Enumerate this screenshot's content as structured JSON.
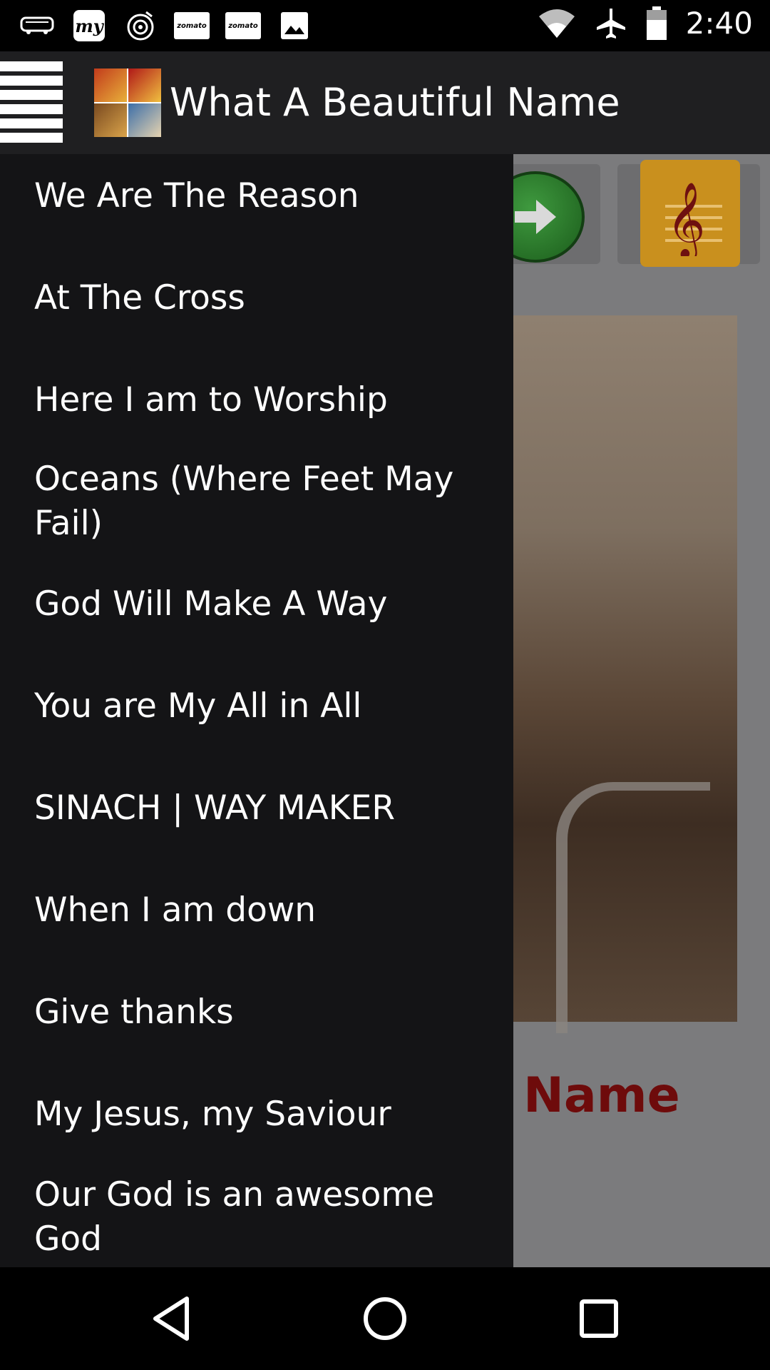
{
  "status_bar": {
    "left_icons": [
      "bus-icon",
      "my-app-icon",
      "music-disc-icon",
      "zomato-icon",
      "zomato-icon",
      "image-icon"
    ],
    "zomato_label": "zomato",
    "my_label": "my",
    "right_icons": [
      "wifi-icon",
      "airplane-icon",
      "battery-icon"
    ],
    "time": "2:40"
  },
  "app_bar": {
    "title": "What A Beautiful Name"
  },
  "drawer": {
    "items": [
      "We Are The Reason",
      "At The Cross",
      "Here I am to Worship",
      "Oceans (Where Feet May Fail)",
      "God Will Make A Way",
      "You are My All in All",
      "SINACH | WAY MAKER",
      "When I am down",
      "Give thanks",
      "My Jesus, my Saviour",
      "Our God is an awesome God"
    ]
  },
  "content": {
    "song_name": "Name"
  },
  "colors": {
    "drawer_bg": "#141416",
    "app_bar_bg": "#1f1f21",
    "title_red": "#6e0b0b"
  }
}
